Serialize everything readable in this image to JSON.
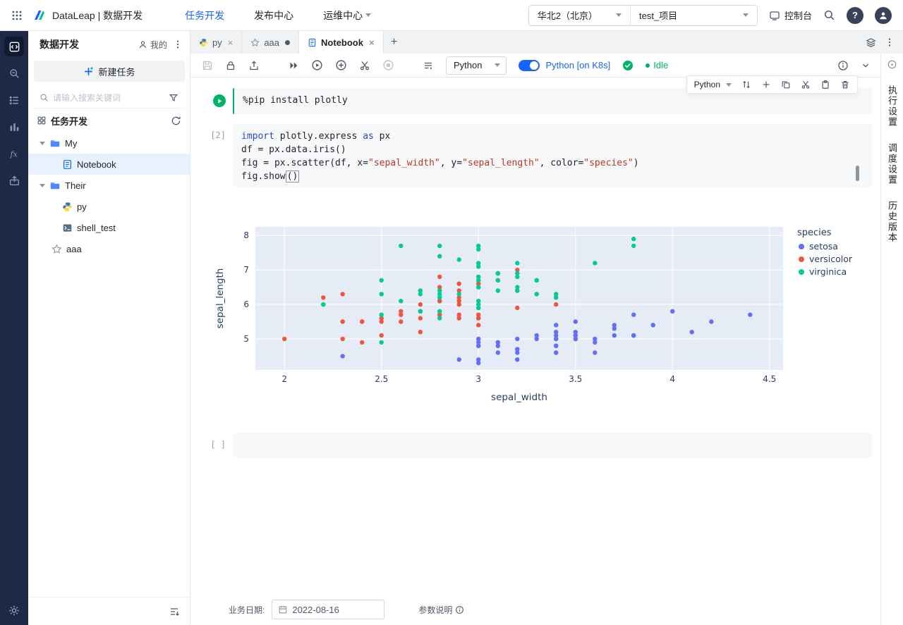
{
  "topbar": {
    "product_title": "DataLeap | 数据开发",
    "nav": [
      {
        "label": "任务开发"
      },
      {
        "label": "发布中心"
      },
      {
        "label": "运维中心"
      }
    ],
    "region": "华北2（北京）",
    "project": "test_项目",
    "console": "控制台"
  },
  "sidebar": {
    "title": "数据开发",
    "mine": "我的",
    "new_task": "新建任务",
    "search_placeholder": "请输入搜索关键词",
    "section_title": "任务开发",
    "tree": {
      "my_label": "My",
      "notebook_label": "Notebook",
      "their_label": "Their",
      "py_label": "py",
      "shell_label": "shell_test",
      "aaa_label": "aaa"
    }
  },
  "tabs": {
    "tab_py": "py",
    "tab_aaa": "aaa",
    "tab_notebook": "Notebook"
  },
  "toolbar": {
    "kernel_select": "Python",
    "runtime_label": "Python [on K8s]",
    "status": "Idle"
  },
  "cell_toolbar": {
    "kernel": "Python"
  },
  "right_panel": {
    "tabs": [
      "执行设置",
      "调度设置",
      "历史版本"
    ]
  },
  "cells": {
    "cell1": {
      "code": [
        "%pip",
        " install plotly"
      ]
    },
    "cell2": {
      "label": "[2]",
      "lines": [
        {
          "tokens": [
            "import",
            " plotly.express ",
            "as",
            " px"
          ]
        },
        {
          "tokens": [
            "df = px.data.iris()"
          ]
        },
        {
          "tokens": [
            "fig = px.scatter(df, x=",
            "\"sepal_width\"",
            ", y=",
            "\"sepal_length\"",
            ", color=",
            "\"species\"",
            ")"
          ]
        },
        {
          "tokens": [
            "fig.show",
            "()"
          ]
        }
      ]
    },
    "empty": {
      "label": "[ ]"
    }
  },
  "footer": {
    "date_label": "业务日期:",
    "date_value": "2022-08-16",
    "params_label": "参数说明"
  },
  "chart_data": {
    "type": "scatter",
    "title": "",
    "xlabel": "sepal_width",
    "ylabel": "sepal_length",
    "xlim": [
      1.85,
      4.57
    ],
    "ylim": [
      4.1,
      8.25
    ],
    "xticks": [
      2,
      2.5,
      3,
      3.5,
      4,
      4.5
    ],
    "yticks": [
      5,
      6,
      7,
      8
    ],
    "plot_bg": "#E5ECF6",
    "grid": true,
    "legend_title": "species",
    "legend_position": "right",
    "series": [
      {
        "name": "setosa",
        "color": "#636EFA",
        "x": [
          3.5,
          3.0,
          3.2,
          3.1,
          3.6,
          3.9,
          3.4,
          3.4,
          2.9,
          3.1,
          3.7,
          3.4,
          3.0,
          3.0,
          4.0,
          4.4,
          3.9,
          3.5,
          3.8,
          3.8,
          3.4,
          3.7,
          3.6,
          3.3,
          3.4,
          3.0,
          3.4,
          3.5,
          3.4,
          3.2,
          3.1,
          3.4,
          4.1,
          4.2,
          3.1,
          3.2,
          3.5,
          3.6,
          3.0,
          3.4,
          3.5,
          2.3,
          3.2,
          3.5,
          3.8,
          3.0,
          3.8,
          3.2,
          3.7,
          3.3
        ],
        "y": [
          5.1,
          4.9,
          4.7,
          4.6,
          5.0,
          5.4,
          4.6,
          5.0,
          4.4,
          4.9,
          5.4,
          4.8,
          4.8,
          4.3,
          5.8,
          5.7,
          5.4,
          5.1,
          5.7,
          5.1,
          5.4,
          5.1,
          4.6,
          5.1,
          4.8,
          5.0,
          5.0,
          5.2,
          5.2,
          4.7,
          4.8,
          5.4,
          5.2,
          5.5,
          4.9,
          5.0,
          5.5,
          4.9,
          4.4,
          5.1,
          5.0,
          4.5,
          4.4,
          5.0,
          5.1,
          4.8,
          5.1,
          4.6,
          5.3,
          5.0
        ]
      },
      {
        "name": "versicolor",
        "color": "#EF553B",
        "x": [
          3.2,
          3.2,
          3.1,
          2.3,
          2.8,
          2.8,
          3.3,
          2.4,
          2.9,
          2.7,
          2.0,
          3.0,
          2.2,
          2.9,
          2.9,
          3.1,
          3.0,
          2.7,
          2.2,
          2.5,
          3.2,
          2.8,
          2.5,
          2.8,
          2.9,
          3.0,
          2.8,
          3.0,
          2.9,
          2.6,
          2.4,
          2.4,
          2.7,
          2.7,
          3.0,
          3.4,
          3.1,
          2.3,
          3.0,
          2.5,
          2.6,
          3.0,
          2.6,
          2.3,
          2.7,
          3.0,
          2.9,
          2.9,
          2.5,
          2.8
        ],
        "y": [
          7.0,
          6.4,
          6.9,
          5.5,
          6.5,
          5.7,
          6.3,
          4.9,
          6.6,
          5.2,
          5.0,
          5.9,
          6.0,
          6.1,
          5.6,
          6.7,
          5.6,
          5.8,
          6.2,
          5.6,
          5.9,
          6.1,
          6.3,
          6.1,
          6.4,
          6.6,
          6.8,
          6.7,
          6.0,
          5.7,
          5.5,
          5.5,
          5.8,
          6.0,
          5.4,
          6.0,
          6.7,
          6.3,
          5.6,
          5.5,
          5.5,
          6.1,
          5.8,
          5.0,
          5.6,
          5.7,
          5.7,
          6.2,
          5.1,
          5.7
        ]
      },
      {
        "name": "virginica",
        "color": "#00CC96",
        "x": [
          3.3,
          2.7,
          3.0,
          2.9,
          3.0,
          3.0,
          2.5,
          2.9,
          2.5,
          3.6,
          3.2,
          2.7,
          3.0,
          2.5,
          2.8,
          3.2,
          3.0,
          3.8,
          2.6,
          2.2,
          3.2,
          2.8,
          2.8,
          2.7,
          3.3,
          3.2,
          2.8,
          3.0,
          2.8,
          3.0,
          2.8,
          3.8,
          2.8,
          2.8,
          2.6,
          3.0,
          3.4,
          3.1,
          3.0,
          3.1,
          3.1,
          3.1,
          2.7,
          3.2,
          3.3,
          3.0,
          2.5,
          3.0,
          3.4,
          3.0
        ],
        "y": [
          6.3,
          5.8,
          7.1,
          6.3,
          6.5,
          7.6,
          4.9,
          7.3,
          6.7,
          7.2,
          6.5,
          6.4,
          6.8,
          5.7,
          5.8,
          6.4,
          6.5,
          7.7,
          7.7,
          6.0,
          6.9,
          5.6,
          7.7,
          6.3,
          6.7,
          7.2,
          6.2,
          6.1,
          6.4,
          7.2,
          7.4,
          7.9,
          6.4,
          6.3,
          6.1,
          7.7,
          6.3,
          6.4,
          6.0,
          6.9,
          6.7,
          6.9,
          5.8,
          6.8,
          6.7,
          6.7,
          6.3,
          6.5,
          6.2,
          5.9
        ]
      }
    ]
  }
}
